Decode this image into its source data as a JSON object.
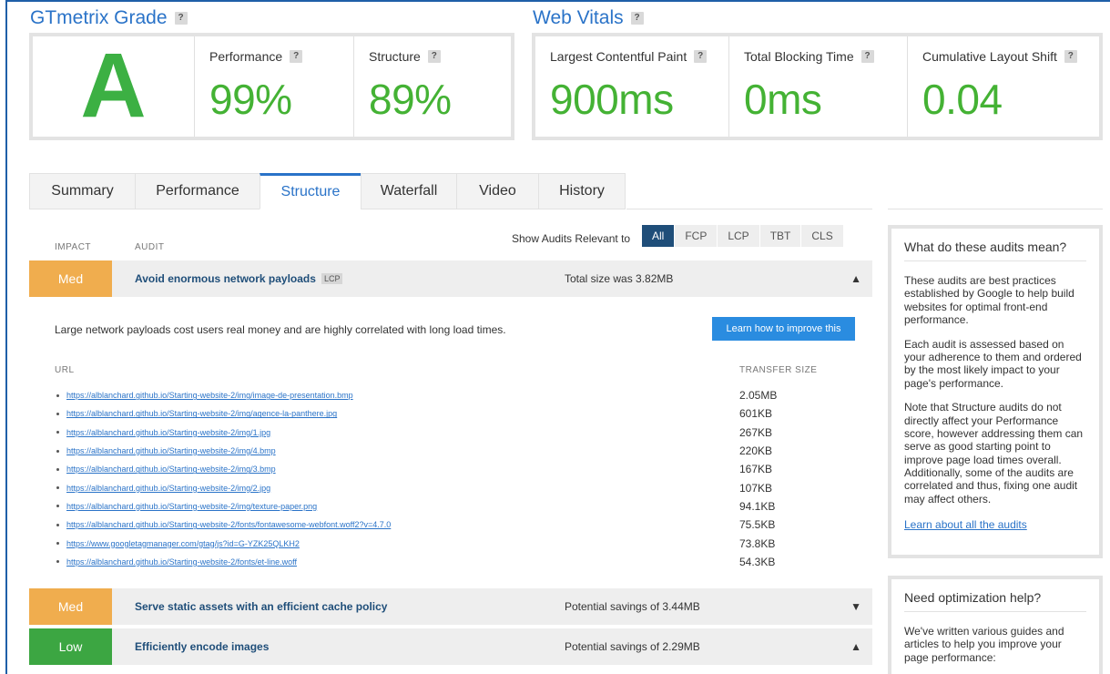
{
  "grade_section": {
    "title": "GTmetrix Grade",
    "help": "?",
    "grade": "A",
    "performance": {
      "label": "Performance",
      "value": "99%"
    },
    "structure": {
      "label": "Structure",
      "value": "89%"
    }
  },
  "vitals_section": {
    "title": "Web Vitals",
    "help": "?",
    "lcp": {
      "label": "Largest Contentful Paint",
      "value": "900ms"
    },
    "tbt": {
      "label": "Total Blocking Time",
      "value": "0ms"
    },
    "cls": {
      "label": "Cumulative Layout Shift",
      "value": "0.04"
    }
  },
  "tabs": [
    "Summary",
    "Performance",
    "Structure",
    "Waterfall",
    "Video",
    "History"
  ],
  "active_tab": "Structure",
  "filter": {
    "label": "Show Audits Relevant to",
    "options": [
      "All",
      "FCP",
      "LCP",
      "TBT",
      "CLS"
    ],
    "selected": "All"
  },
  "table_headers": {
    "impact": "IMPACT",
    "audit": "AUDIT"
  },
  "audits": [
    {
      "impact": "Med",
      "name": "Avoid enormous network payloads",
      "tag": "LCP",
      "meta": "Total size was 3.82MB",
      "expanded": true,
      "description": "Large network payloads cost users real money and are highly correlated with long load times.",
      "button": "Learn how to improve this",
      "url_header": "URL",
      "size_header": "TRANSFER SIZE",
      "rows": [
        {
          "url": "https://alblanchard.github.io/Starting-website-2/img/image-de-presentation.bmp",
          "size": "2.05MB"
        },
        {
          "url": "https://alblanchard.github.io/Starting-website-2/img/agence-la-panthere.jpg",
          "size": "601KB"
        },
        {
          "url": "https://alblanchard.github.io/Starting-website-2/img/1.jpg",
          "size": "267KB"
        },
        {
          "url": "https://alblanchard.github.io/Starting-website-2/img/4.bmp",
          "size": "220KB"
        },
        {
          "url": "https://alblanchard.github.io/Starting-website-2/img/3.bmp",
          "size": "167KB"
        },
        {
          "url": "https://alblanchard.github.io/Starting-website-2/img/2.jpg",
          "size": "107KB"
        },
        {
          "url": "https://alblanchard.github.io/Starting-website-2/img/texture-paper.png",
          "size": "94.1KB"
        },
        {
          "url": "https://alblanchard.github.io/Starting-website-2/fonts/fontawesome-webfont.woff2?v=4.7.0",
          "size": "75.5KB"
        },
        {
          "url": "https://www.googletagmanager.com/gtag/js?id=G-YZK25QLKH2",
          "size": "73.8KB"
        },
        {
          "url": "https://alblanchard.github.io/Starting-website-2/fonts/et-line.woff",
          "size": "54.3KB"
        }
      ]
    },
    {
      "impact": "Med",
      "name": "Serve static assets with an efficient cache policy",
      "meta": "Potential savings of 3.44MB",
      "expanded": false
    },
    {
      "impact": "Low",
      "name": "Efficiently encode images",
      "meta": "Potential savings of 2.29MB",
      "expanded": true
    }
  ],
  "side_audits": {
    "title": "What do these audits mean?",
    "p1": "These audits are best practices established by Google to help build websites for optimal front-end performance.",
    "p2": "Each audit is assessed based on your adherence to them and ordered by the most likely impact to your page's performance.",
    "p3": "Note that Structure audits do not directly affect your Performance score, however addressing them can serve as good starting point to improve page load times overall. Additionally, some of the audits are correlated and thus, fixing one audit may affect others.",
    "link": "Learn about all the audits"
  },
  "side_help": {
    "title": "Need optimization help?",
    "p1": "We've written various guides and articles to help you improve your page performance:"
  },
  "colors": {
    "accent": "#2a73c8",
    "green": "#44b234",
    "med": "#f0ad4e",
    "low": "#3ca642",
    "filter_active": "#1f4e79"
  }
}
